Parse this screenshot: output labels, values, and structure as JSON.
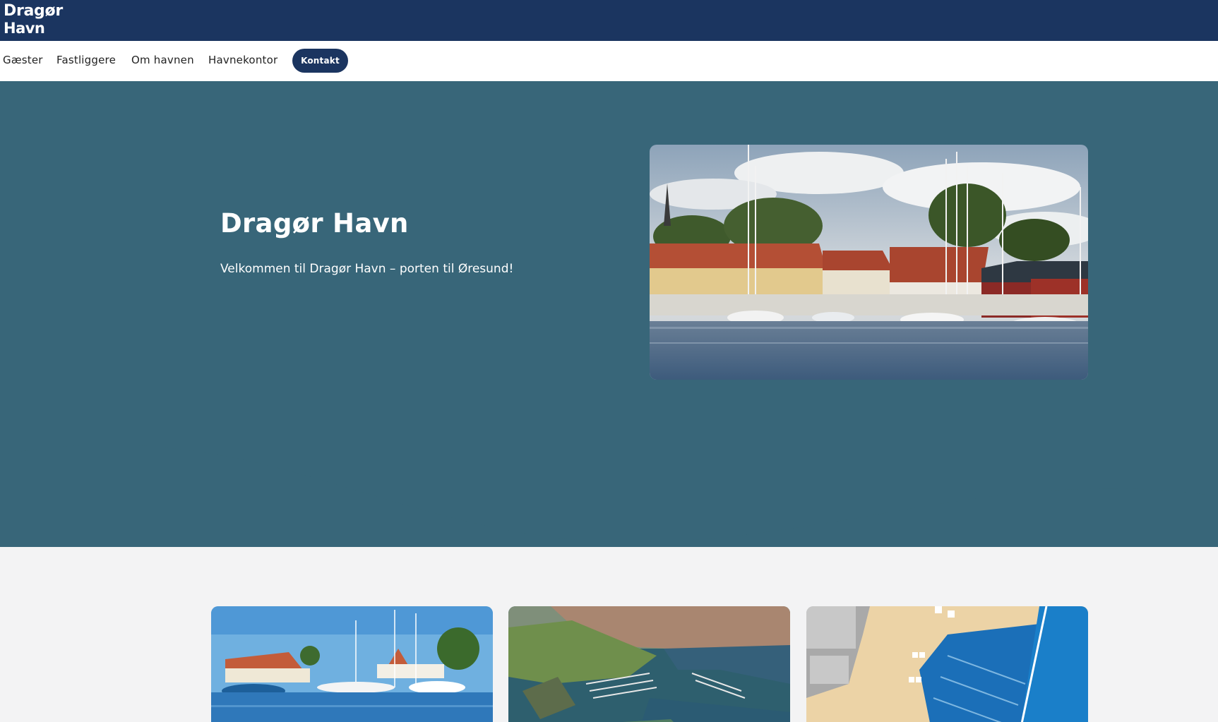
{
  "brand": {
    "line1": "Dragør",
    "line2": "Havn"
  },
  "nav": {
    "items": [
      "Gæster",
      "Fastliggere",
      "Om havnen",
      "Havnekontor"
    ],
    "cta": "Kontakt"
  },
  "hero": {
    "title": "Dragør Havn",
    "subtitle": "Velkommen til Dragør Havn – porten til Øresund!"
  },
  "colors": {
    "header": "#1b3560",
    "hero": "#386679",
    "page": "#f3f3f4",
    "cta": "#1b3560"
  }
}
